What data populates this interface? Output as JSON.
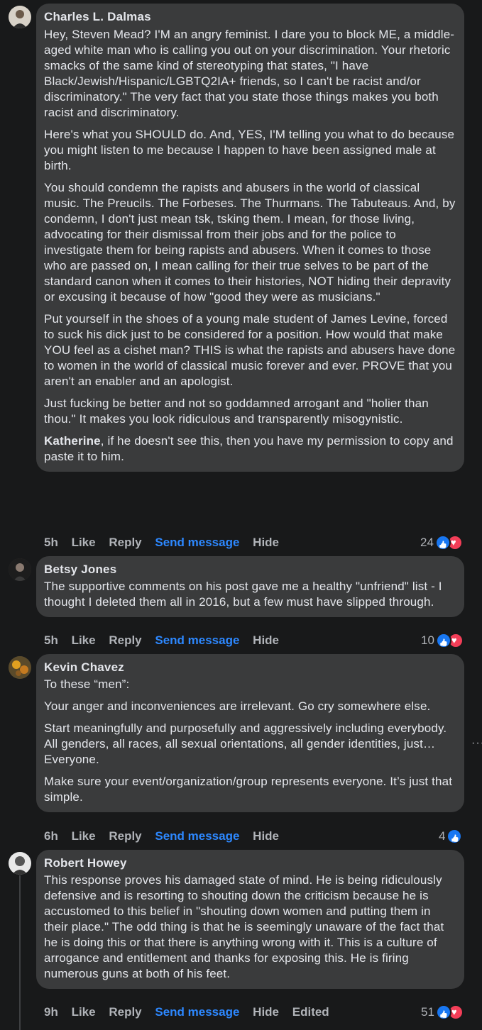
{
  "comments": [
    {
      "author": "Charles L. Dalmas",
      "paragraphs": [
        "Hey, Steven Mead? I'M an angry feminist. I dare you to block ME, a middle-aged white man who is calling you out on your discrimination. Your rhetoric smacks of the same kind of stereotyping that states, \"I have Black/Jewish/Hispanic/LGBTQ2IA+ friends, so I can't be racist and/or discriminatory.\" The very fact that you state those things makes you both racist and discriminatory.",
        "Here's what you SHOULD do. And, YES, I'M telling you what to do because you might listen to me because I happen to have been assigned male at birth.",
        "You should condemn the rapists and abusers in the world of classical music. The Preucils. The Forbeses. The Thurmans. The Tabuteaus. And, by condemn, I don't just mean tsk, tsking them. I mean, for those living, advocating for their dismissal from their jobs and for the police to investigate them for being rapists and abusers. When it comes to those who are passed on, I mean calling for their true selves to be part of the standard canon when it comes to their histories, NOT hiding their depravity or excusing it because of how \"good they were as musicians.\"",
        "Put yourself in the shoes of a young male student of James Levine, forced to suck his dick just to be considered for a position. How would that make YOU feel as a cishet man? THIS is what the rapists and abusers have done to women in the world of classical music forever and ever. PROVE that you aren't an enabler and an apologist.",
        "Just fucking be better and not so goddamned arrogant and \"holier than thou.\" It makes you look ridiculous and transparently misogynistic."
      ],
      "mention": "Katherine",
      "mention_tail": ", if he doesn't see this, then you have my permission to copy and paste it to him.",
      "time": "5h",
      "like": "Like",
      "reply": "Reply",
      "send": "Send message",
      "hide": "Hide",
      "reactions": "24"
    },
    {
      "author": "Betsy Jones",
      "paragraphs": [
        "The supportive comments on his post gave me a healthy \"unfriend\" list - I thought I deleted them all in 2016, but a few must have slipped through."
      ],
      "time": "5h",
      "like": "Like",
      "reply": "Reply",
      "send": "Send message",
      "hide": "Hide",
      "reactions": "10"
    },
    {
      "author": "Kevin Chavez",
      "paragraphs": [
        "To these “men”:",
        "Your anger and inconveniences are irrelevant. Go cry somewhere else.",
        "Start meaningfully and purposefully and aggressively including everybody. All genders, all races, all sexual orientations, all gender identities, just… Everyone.",
        "Make sure your event/organization/group represents everyone. It’s just that simple."
      ],
      "time": "6h",
      "like": "Like",
      "reply": "Reply",
      "send": "Send message",
      "hide": "Hide",
      "reactions": "4"
    },
    {
      "author": "Robert Howey",
      "paragraphs": [
        "This response proves his damaged state of mind. He is being ridiculously defensive and is resorting to shouting down the criticism because he is accustomed to this belief in \"shouting down women and putting them in their place.\" The odd thing is that he is seemingly unaware of the fact that he is doing this or that there is anything wrong with it. This is a culture of arrogance and entitlement and thanks for exposing this. He is firing numerous guns at both of his feet."
      ],
      "time": "9h",
      "like": "Like",
      "reply": "Reply",
      "send": "Send message",
      "hide": "Hide",
      "edited": "Edited",
      "reactions": "51"
    }
  ],
  "colors": {
    "background": "#18191a",
    "bubble": "#3a3b3c",
    "text": "#e4e6eb",
    "secondary": "#b0b3b8",
    "link": "#2d88ff",
    "like": "#1877f2",
    "love": "#f33e58"
  },
  "icons": [
    "like-reaction-icon",
    "love-reaction-icon",
    "more-options-icon"
  ],
  "more_dots": "···"
}
